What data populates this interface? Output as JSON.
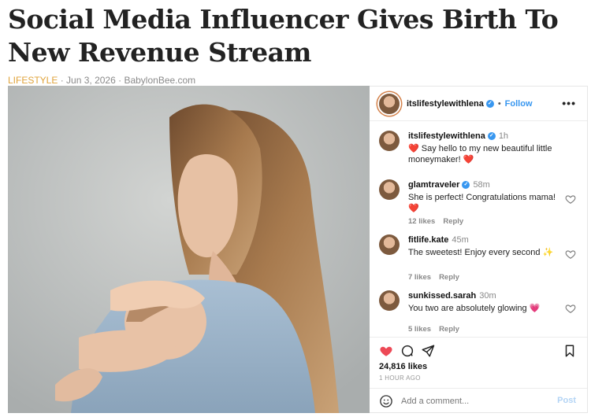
{
  "article": {
    "headline": "Social Media Influencer Gives Birth To New Revenue Stream",
    "category": "LIFESTYLE",
    "date": "Jun 3, 2026",
    "site": "BabylonBee.com",
    "separator": "·"
  },
  "instagram": {
    "header": {
      "username": "itslifestylewithlena",
      "follow_label": "Follow",
      "more_icon": "more-horizontal-icon"
    },
    "caption": {
      "username": "itslifestylewithlena",
      "time": "1h",
      "text": "❤️ Say hello to my new beautiful little moneymaker! ❤️"
    },
    "comments": [
      {
        "username": "glamtraveler",
        "verified": true,
        "time": "58m",
        "text": "She is perfect! Congratulations mama! ❤️",
        "likes": "12 likes",
        "reply": "Reply"
      },
      {
        "username": "fitlife.kate",
        "verified": false,
        "time": "45m",
        "text": "The sweetest! Enjoy every second ✨",
        "likes": "7 likes",
        "reply": "Reply"
      },
      {
        "username": "sunkissed.sarah",
        "verified": false,
        "time": "30m",
        "text": "You two are absolutely glowing 💗",
        "likes": "5 likes",
        "reply": "Reply"
      }
    ],
    "likes_count": "24,816 likes",
    "posted_ago": "1 HOUR AGO",
    "add_comment_placeholder": "Add a comment...",
    "post_label": "Post",
    "colors": {
      "accent": "#3897f0",
      "like_red": "#ed4956",
      "category": "#e0a33a"
    }
  }
}
